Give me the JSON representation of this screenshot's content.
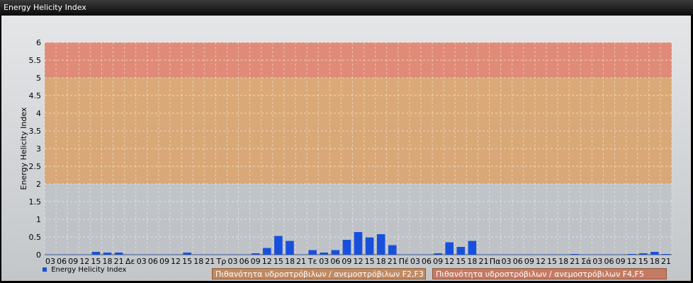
{
  "window": {
    "title": "Energy Helicity Index"
  },
  "colors": {
    "bar": "#1750dd",
    "band_red": "#e0826c",
    "band_orange": "#d9a36b",
    "band_low": "#bec2c6",
    "band_legend_1": "#c08a62",
    "band_legend_2": "#c47a64"
  },
  "legend": {
    "series_label": "Energy Helicity Index",
    "band_1": "Πιθανότητα υδροστρόβιλων / ανεμοστρόβιλων F2,F3",
    "band_2": "Πιθανότητα υδροστρόβιλων / ανεμοστρόβιλων F4,F5"
  },
  "chart_data": {
    "type": "bar",
    "title": "",
    "ylabel": "Energy Helicity Index",
    "xlabel": "",
    "ylim": [
      0,
      6
    ],
    "yticks": [
      "0",
      "0.5",
      "1",
      "1.5",
      "2",
      "2.5",
      "3",
      "3.5",
      "4",
      "4.5",
      "5",
      "5.5",
      "6"
    ],
    "bands": [
      {
        "from": 2,
        "to": 5,
        "label": "Πιθανότητα υδροστρόβιλων / ανεμοστρόβιλων F2,F3"
      },
      {
        "from": 5,
        "to": 6,
        "label": "Πιθανότητα υδροστρόβιλων / ανεμοστρόβιλων F4,F5"
      }
    ],
    "categories": [
      "03",
      "06",
      "09",
      "12",
      "15",
      "18",
      "21",
      "Δε",
      "03",
      "06",
      "09",
      "12",
      "15",
      "18",
      "21",
      "Τρ",
      "03",
      "06",
      "09",
      "12",
      "15",
      "18",
      "21",
      "Τε",
      "03",
      "06",
      "09",
      "12",
      "15",
      "18",
      "21",
      "Πέ",
      "03",
      "06",
      "09",
      "12",
      "15",
      "18",
      "21",
      "Πα",
      "03",
      "06",
      "09",
      "12",
      "15",
      "18",
      "21",
      "Σά",
      "03",
      "06",
      "09",
      "12",
      "15",
      "18",
      "21"
    ],
    "series": [
      {
        "name": "Energy Helicity Index",
        "values": [
          0.01,
          0.01,
          0.01,
          0.01,
          0.08,
          0.06,
          0.06,
          0.01,
          0.01,
          0.01,
          0.01,
          0.01,
          0.06,
          0.01,
          0.01,
          0.01,
          0.01,
          0.01,
          0.04,
          0.19,
          0.53,
          0.39,
          0.01,
          0.13,
          0.06,
          0.13,
          0.42,
          0.64,
          0.49,
          0.58,
          0.27,
          0.01,
          0.01,
          0.01,
          0.04,
          0.35,
          0.22,
          0.39,
          0.01,
          0.01,
          0.01,
          0.01,
          0.01,
          0.01,
          0.01,
          0.01,
          0.02,
          0.01,
          0.01,
          0.01,
          0.01,
          0.02,
          0.04,
          0.08,
          0.02
        ]
      }
    ]
  }
}
